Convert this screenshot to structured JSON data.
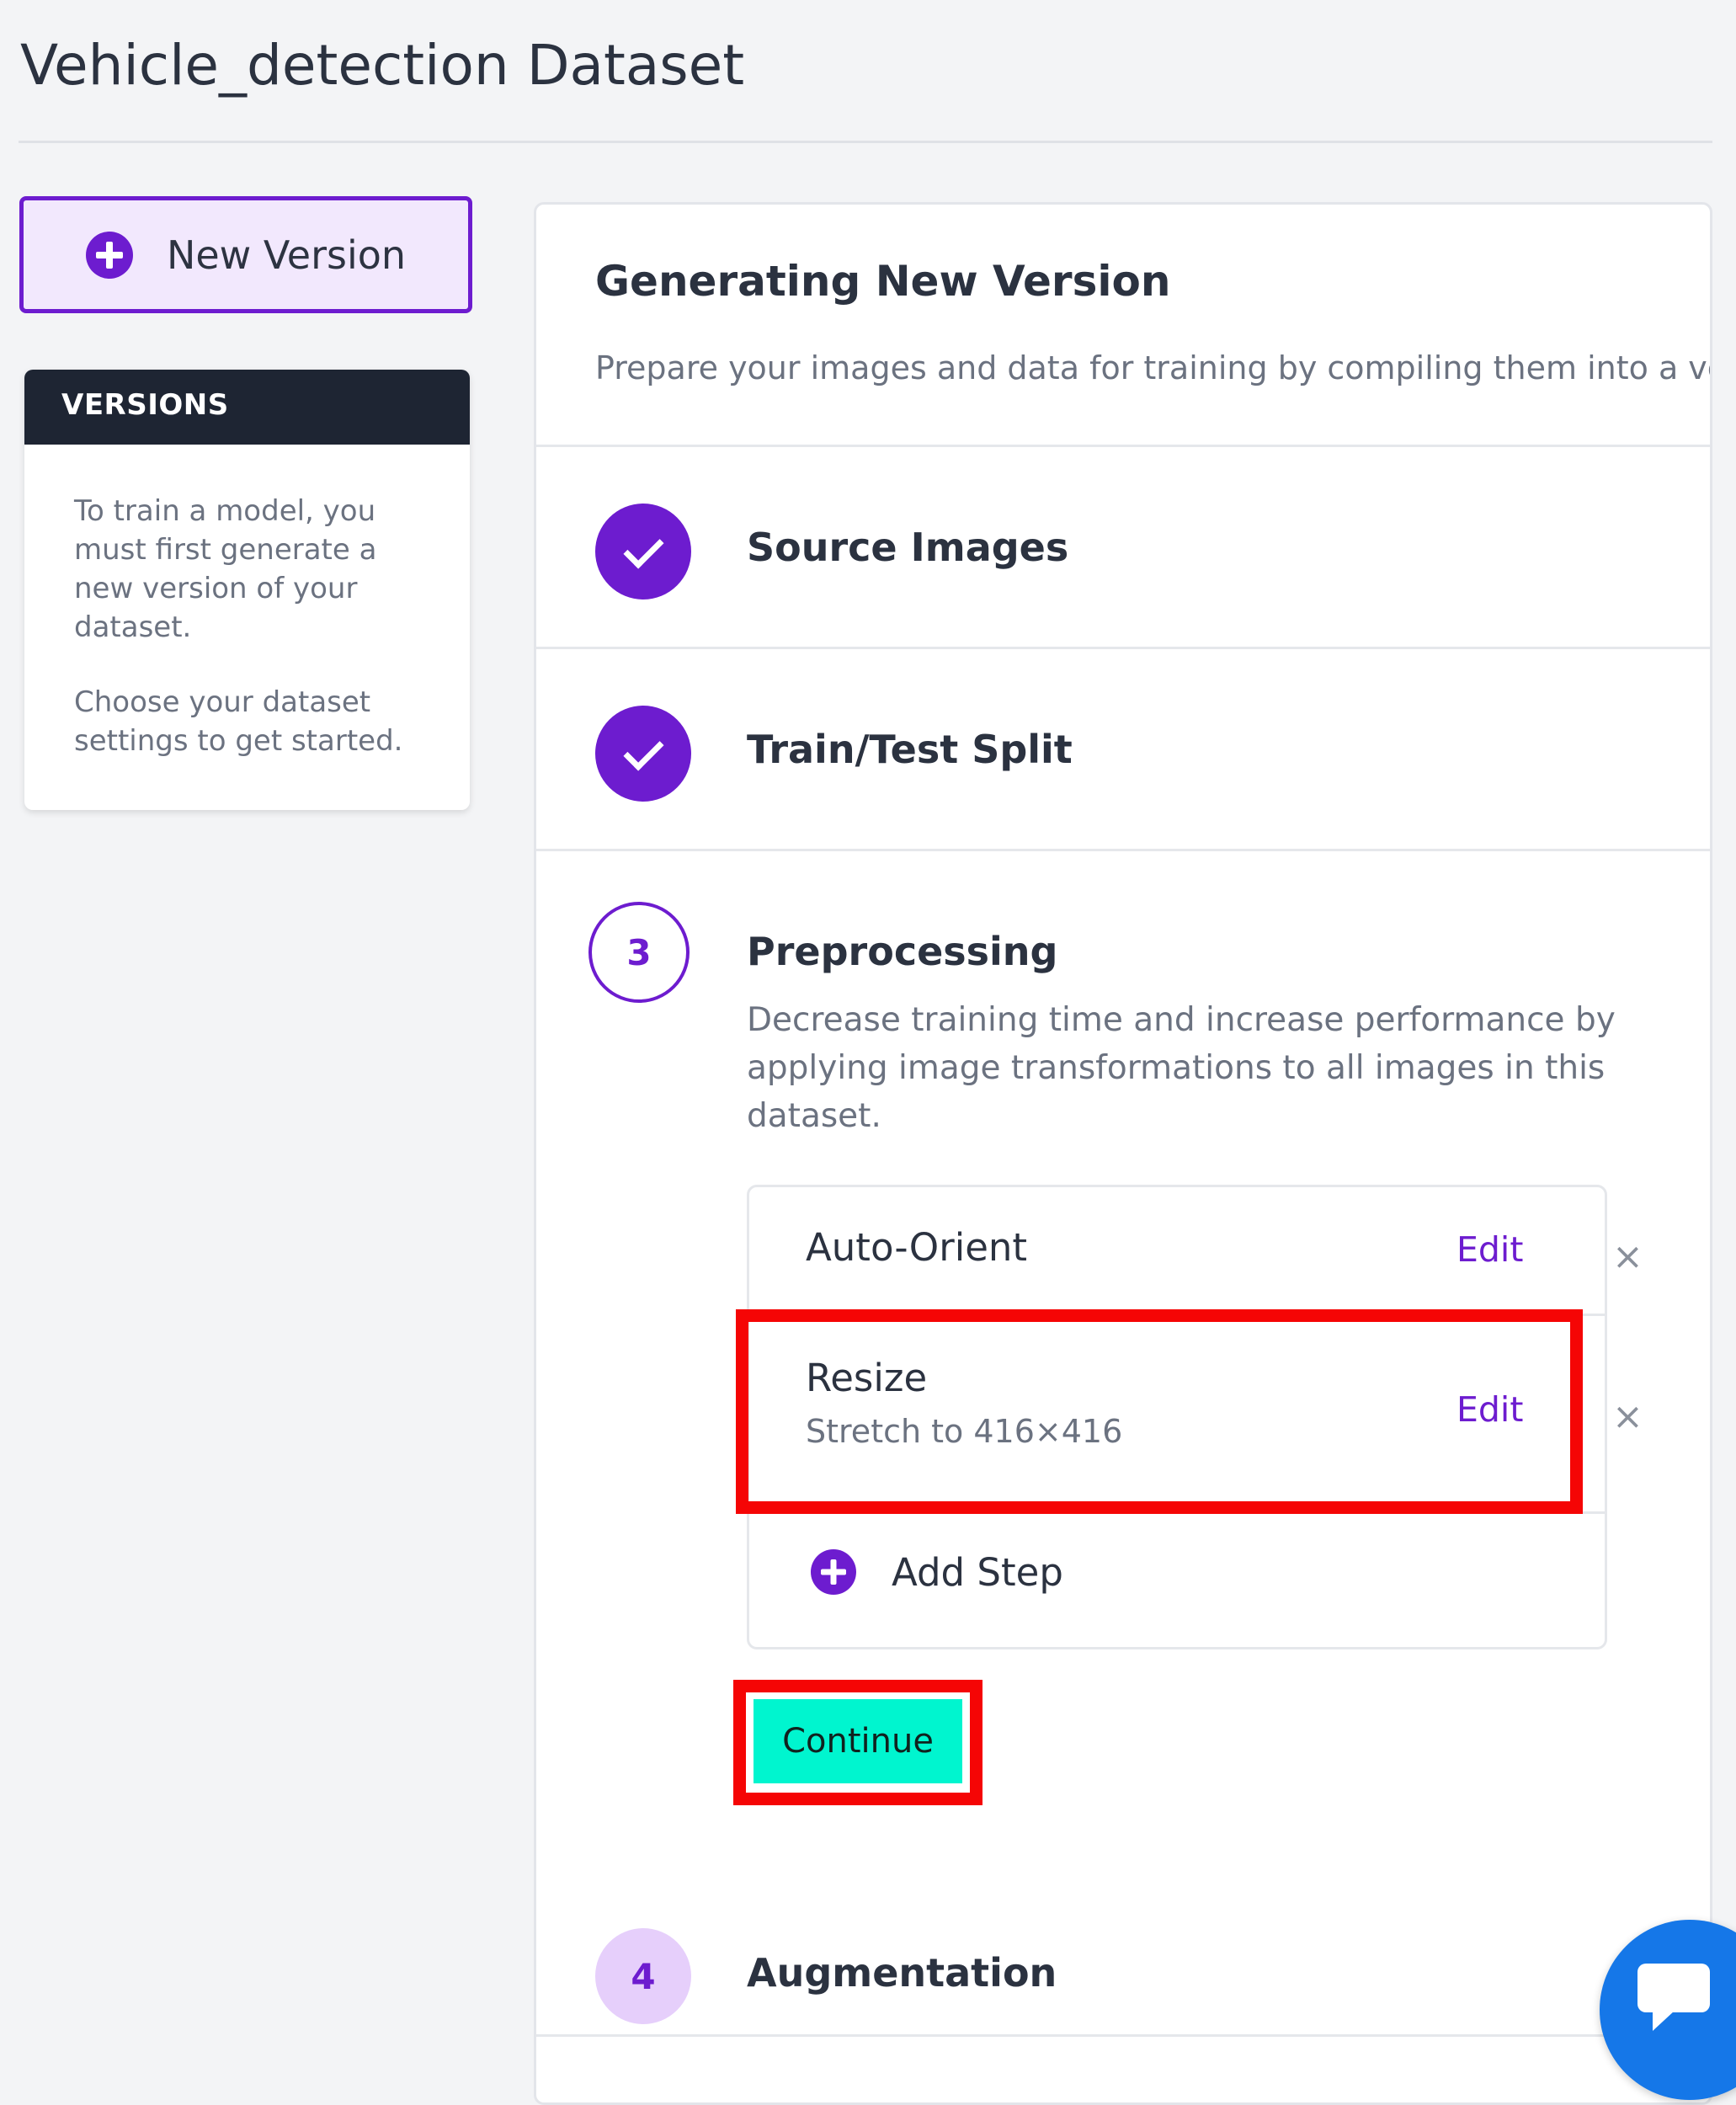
{
  "page": {
    "title": "Vehicle_detection Dataset"
  },
  "sidebar": {
    "new_version_label": "New Version",
    "versions_title": "VERSIONS",
    "versions_text_1": "To train a model, you must first generate a new version of your dataset.",
    "versions_text_2": "Choose your dataset settings to get started."
  },
  "main": {
    "title": "Generating New Version",
    "subtitle": "Prepare your images and data for training by compiling them into a vers",
    "steps": [
      {
        "title": "Source Images",
        "status": "complete"
      },
      {
        "title": "Train/Test Split",
        "status": "complete"
      },
      {
        "number": "3",
        "title": "Preprocessing",
        "status": "active",
        "description": "Decrease training time and increase performance by applying image transformations to all images in this dataset."
      },
      {
        "number": "4",
        "title": "Augmentation",
        "status": "pending"
      }
    ],
    "preprocessing_items": [
      {
        "title": "Auto-Orient",
        "edit_label": "Edit",
        "remove_label": "×"
      },
      {
        "title": "Resize",
        "subtitle": "Stretch to 416×416",
        "edit_label": "Edit",
        "remove_label": "×"
      }
    ],
    "add_step_label": "Add Step",
    "continue_label": "Continue"
  },
  "colors": {
    "accent": "#6d1ccf",
    "continue": "#00f5cf",
    "highlight": "#f50505",
    "chat": "#1577e8"
  },
  "icons": {
    "new_version": "plus-circle-icon",
    "step_done": "check-icon",
    "remove": "close-icon",
    "add_step": "plus-circle-icon",
    "chat": "chat-bubble-icon"
  }
}
